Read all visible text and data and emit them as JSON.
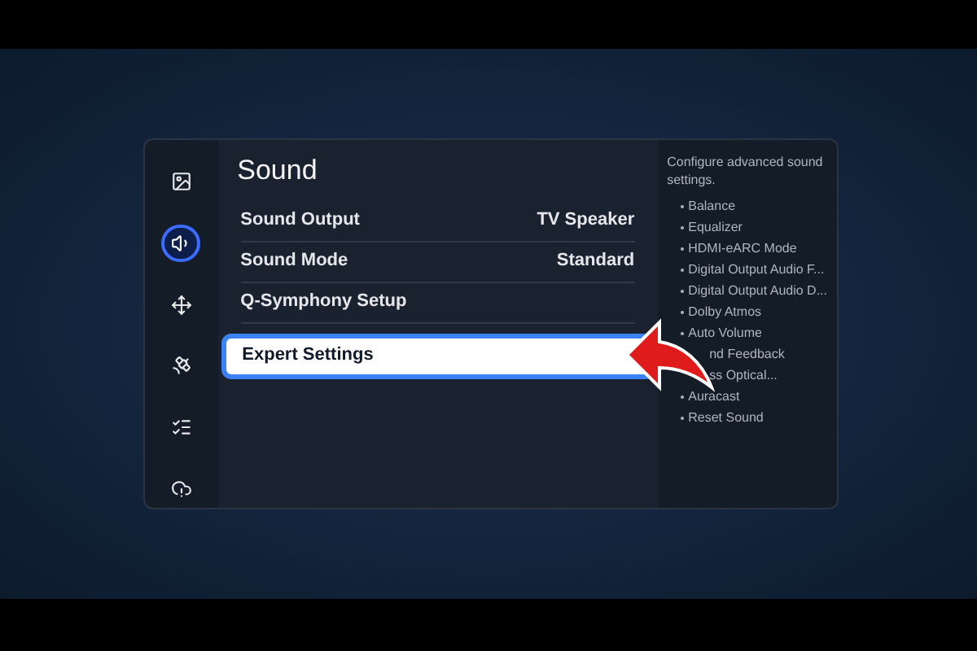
{
  "sidebar": {
    "items": [
      {
        "selected": false
      },
      {
        "selected": true
      },
      {
        "selected": false
      },
      {
        "selected": false
      },
      {
        "selected": false
      },
      {
        "selected": false
      }
    ]
  },
  "title": "Sound",
  "menu": [
    {
      "label": "Sound Output",
      "value": "TV Speaker",
      "selected": false
    },
    {
      "label": "Sound Mode",
      "value": "Standard",
      "selected": false
    },
    {
      "label": "Q-Symphony Setup",
      "selected": false
    },
    {
      "label": "Expert Settings",
      "selected": true
    }
  ],
  "help": {
    "description": "Configure advanced sound settings.",
    "items": [
      {
        "text": "Balance",
        "kind": "full"
      },
      {
        "text": "Equalizer",
        "kind": "full"
      },
      {
        "text": "HDMI-eARC Mode",
        "kind": "full"
      },
      {
        "text": "Digital Output Audio F...",
        "kind": "full"
      },
      {
        "text": "Digital Output Audio D...",
        "kind": "full"
      },
      {
        "text": "Dolby Atmos",
        "kind": "full"
      },
      {
        "text": "Auto Volume",
        "kind": "full"
      },
      {
        "text": "nd Feedback",
        "kind": "partial"
      },
      {
        "text": "ss Optical...",
        "kind": "partial"
      },
      {
        "text": "Auracast",
        "kind": "full"
      },
      {
        "text": "Reset Sound",
        "kind": "full"
      }
    ]
  }
}
